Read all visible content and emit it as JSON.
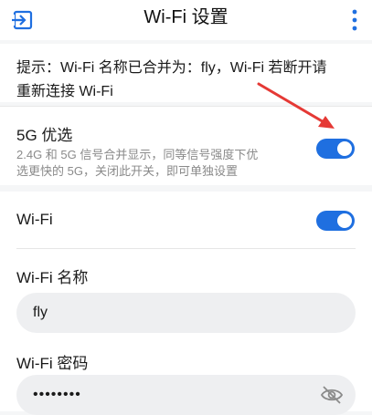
{
  "header": {
    "title": "Wi-Fi 设置",
    "back_icon": "back-exit-icon",
    "more_icon": "more-vertical-icon"
  },
  "tip": {
    "text_line1": "提示：Wi-Fi 名称已合并为：fly，Wi-Fi 若断开请",
    "text_line2": "重新连接 Wi-Fi"
  },
  "band_5g": {
    "title": "5G 优选",
    "description_line1": "2.4G 和 5G 信号合并显示，同等信号强度下优",
    "description_line2": "选更快的 5G，关闭此开关，即可单独设置",
    "enabled": true
  },
  "wifi": {
    "label": "Wi-Fi",
    "enabled": true,
    "name_label": "Wi-Fi 名称",
    "name_value": "fly",
    "password_label": "Wi-Fi 密码",
    "password_value": "••••••••",
    "visibility_icon": "eye-off-icon"
  },
  "colors": {
    "accent": "#1f6fe0",
    "annotation_arrow": "#e53935"
  }
}
